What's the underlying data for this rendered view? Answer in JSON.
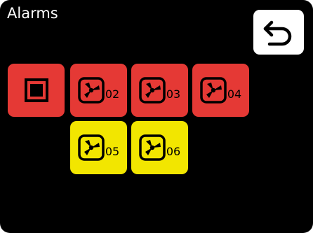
{
  "header": {
    "title": "Alarms",
    "back_icon": "undo-arrow-icon"
  },
  "colors": {
    "background": "#000000",
    "alarm_red": "#e53935",
    "warning_yellow": "#f2e600",
    "text": "#ffffff"
  },
  "tiles": [
    {
      "kind": "stop",
      "icon": "stop-square-icon",
      "label": "",
      "color": "red"
    },
    {
      "kind": "fan",
      "icon": "fan-icon",
      "label": "02",
      "color": "red"
    },
    {
      "kind": "fan",
      "icon": "fan-icon",
      "label": "03",
      "color": "red"
    },
    {
      "kind": "fan",
      "icon": "fan-icon",
      "label": "04",
      "color": "red"
    },
    {
      "kind": "fan",
      "icon": "fan-icon",
      "label": "05",
      "color": "yellow"
    },
    {
      "kind": "fan",
      "icon": "fan-icon",
      "label": "06",
      "color": "yellow"
    }
  ]
}
